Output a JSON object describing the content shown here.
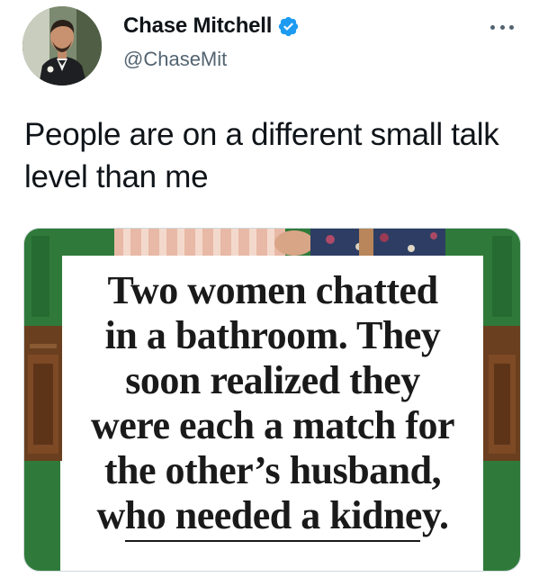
{
  "author": {
    "display_name": "Chase Mitchell",
    "handle": "@ChaseMit",
    "verified": true
  },
  "tweet": {
    "text": "People are on a different small talk level than me"
  },
  "media": {
    "headline_lines": [
      "Two women chatted",
      "in a bathroom. They",
      "soon realized they",
      "were each a match for",
      "the other’s husband,",
      "who needed a kidney."
    ]
  },
  "icons": {
    "verified": "verified-badge-icon",
    "more": "more-options-icon"
  },
  "colors": {
    "verified_blue": "#1d9bf0",
    "secondary_text": "#536471",
    "primary_text": "#0f1419",
    "media_green": "#2f7a3a"
  }
}
